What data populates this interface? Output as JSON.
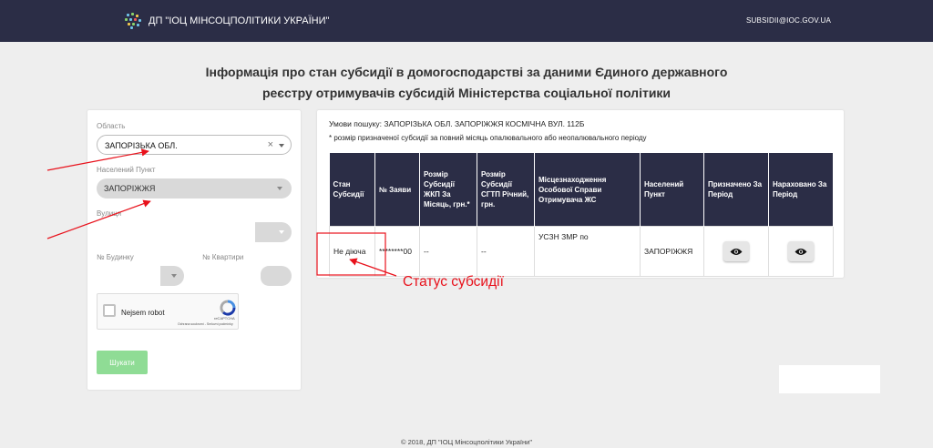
{
  "header": {
    "brand": "ДП \"ІОЦ МІНСОЦПОЛІТИКИ УКРАЇНИ\"",
    "email": "SUBSIDII@IOC.GOV.UA"
  },
  "page_title_line1": "Інформація про стан субсидії в домогосподарстві за даними Єдиного державного",
  "page_title_line2": "реєстру отримувачів субсидій Міністерства соціальної політики",
  "form": {
    "region_label": "Область",
    "region_value": "ЗАПОРІЗЬКА ОБЛ.",
    "clear_symbol": "×",
    "city_label": "Населений Пункт",
    "city_value": "ЗАПОРІЖЖЯ",
    "street_label": "Вулиця",
    "house_label": "№ Будинку",
    "apartment_label": "№ Квартири",
    "captcha_text": "Nejsem robot",
    "captcha_brand": "reCAPTCHA",
    "captcha_terms": "Ochrana soukromí - Smluvní podmínky",
    "search_button": "Шукати"
  },
  "results": {
    "conditions": "Умови пошуку: ЗАПОРІЗЬКА ОБЛ. ЗАПОРІЖЖЯ КОСМІЧНА ВУЛ. 112Б",
    "note": "* розмір призначеної субсидії за повний місяць опалювального або неопалювального періоду",
    "columns": [
      "Стан Субсидії",
      "№ Заяви",
      "Розмір Субсидії ЖКП За Місяць, грн.*",
      "Розмір Субсидії СГТП Річний, грн.",
      "Місцезнаходження Особової Справи Отримувача ЖС",
      "Населений Пункт",
      "Призначено За Період",
      "Нараховано За Період"
    ],
    "row": {
      "status": "Не діюча",
      "application_no": "********00",
      "monthly_amount": "--",
      "annual_amount": "--",
      "office": "УСЗН ЗМР по",
      "city": "ЗАПОРІЖЖЯ"
    }
  },
  "annotation": "Статус субсидії",
  "annotation_color": "#e8111b",
  "footer": "© 2018, ДП \"ІОЦ Мінсоцполітики України\""
}
